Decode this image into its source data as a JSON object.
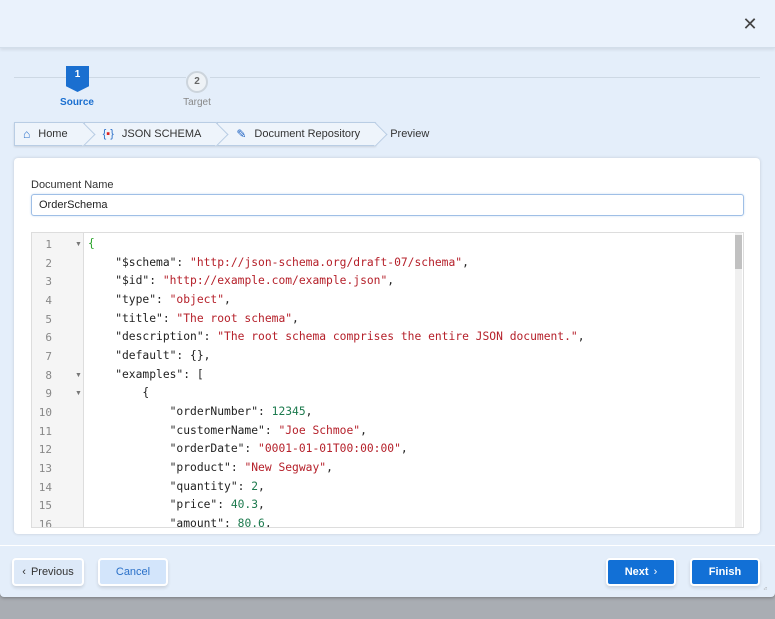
{
  "dialog": {
    "close_icon": "close-icon"
  },
  "stepper": {
    "steps": [
      {
        "number": "1",
        "label": "Source",
        "active": true
      },
      {
        "number": "2",
        "label": "Target",
        "active": false
      }
    ]
  },
  "breadcrumb": [
    {
      "label": "Home",
      "icon": "home-icon"
    },
    {
      "label": "JSON SCHEMA",
      "icon": "json-schema-icon"
    },
    {
      "label": "Document Repository",
      "icon": "repository-icon"
    },
    {
      "label": "Preview"
    }
  ],
  "form": {
    "document_name_label": "Document Name",
    "document_name_value": "OrderSchema"
  },
  "editor": {
    "lines": [
      {
        "n": "1",
        "fold": true,
        "tokens": [
          [
            "brace",
            "{"
          ]
        ]
      },
      {
        "n": "2",
        "tokens": [
          [
            "key",
            "    \"$schema\": "
          ],
          [
            "str",
            "\"http://json-schema.org/draft-07/schema\""
          ],
          [
            "key",
            ","
          ]
        ]
      },
      {
        "n": "3",
        "tokens": [
          [
            "key",
            "    \"$id\": "
          ],
          [
            "str",
            "\"http://example.com/example.json\""
          ],
          [
            "key",
            ","
          ]
        ]
      },
      {
        "n": "4",
        "tokens": [
          [
            "key",
            "    \"type\": "
          ],
          [
            "str",
            "\"object\""
          ],
          [
            "key",
            ","
          ]
        ]
      },
      {
        "n": "5",
        "tokens": [
          [
            "key",
            "    \"title\": "
          ],
          [
            "str",
            "\"The root schema\""
          ],
          [
            "key",
            ","
          ]
        ]
      },
      {
        "n": "6",
        "tokens": [
          [
            "key",
            "    \"description\": "
          ],
          [
            "str",
            "\"The root schema comprises the entire JSON document.\""
          ],
          [
            "key",
            ","
          ]
        ]
      },
      {
        "n": "7",
        "tokens": [
          [
            "key",
            "    \"default\": {},"
          ]
        ]
      },
      {
        "n": "8",
        "fold": true,
        "tokens": [
          [
            "key",
            "    \"examples\": ["
          ]
        ]
      },
      {
        "n": "9",
        "fold": true,
        "tokens": [
          [
            "key",
            "        {"
          ]
        ]
      },
      {
        "n": "10",
        "tokens": [
          [
            "key",
            "            \"orderNumber\": "
          ],
          [
            "num",
            "12345"
          ],
          [
            "key",
            ","
          ]
        ]
      },
      {
        "n": "11",
        "tokens": [
          [
            "key",
            "            \"customerName\": "
          ],
          [
            "str",
            "\"Joe Schmoe\""
          ],
          [
            "key",
            ","
          ]
        ]
      },
      {
        "n": "12",
        "tokens": [
          [
            "key",
            "            \"orderDate\": "
          ],
          [
            "str",
            "\"0001-01-01T00:00:00\""
          ],
          [
            "key",
            ","
          ]
        ]
      },
      {
        "n": "13",
        "tokens": [
          [
            "key",
            "            \"product\": "
          ],
          [
            "str",
            "\"New Segway\""
          ],
          [
            "key",
            ","
          ]
        ]
      },
      {
        "n": "14",
        "tokens": [
          [
            "key",
            "            \"quantity\": "
          ],
          [
            "num",
            "2"
          ],
          [
            "key",
            ","
          ]
        ]
      },
      {
        "n": "15",
        "tokens": [
          [
            "key",
            "            \"price\": "
          ],
          [
            "num",
            "40.3"
          ],
          [
            "key",
            ","
          ]
        ]
      },
      {
        "n": "16",
        "tokens": [
          [
            "key",
            "            \"amount\": "
          ],
          [
            "num",
            "80.6"
          ],
          [
            "key",
            ","
          ]
        ]
      }
    ]
  },
  "footer": {
    "previous": "Previous",
    "cancel": "Cancel",
    "next": "Next",
    "finish": "Finish"
  },
  "colors": {
    "primary": "#1270d6",
    "active_step": "#1a6fd0",
    "string": "#b5202a",
    "number": "#1d7a4e"
  }
}
